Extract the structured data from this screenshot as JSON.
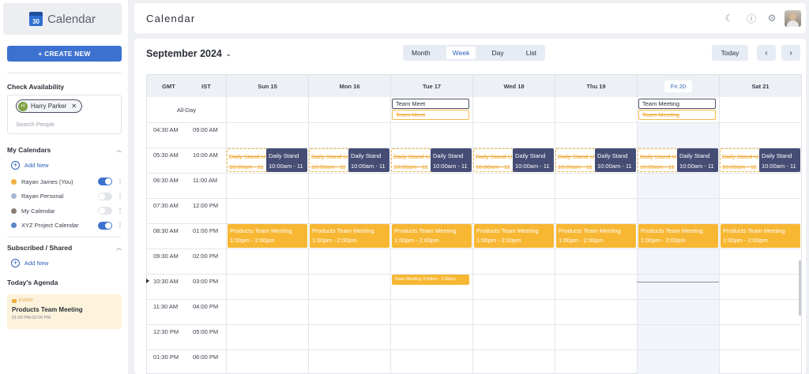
{
  "app": {
    "name": "Calendar",
    "logo_day": "30"
  },
  "sidebar": {
    "create_label": "+ CREATE NEW",
    "check_availability": {
      "title": "Check Availability",
      "chip_name": "Harry Parker",
      "chip_initial": "H",
      "search_placeholder": "Search People"
    },
    "my_calendars": {
      "title": "My Calendars",
      "add_label": "Add New",
      "items": [
        {
          "label": "Rayan James (You)",
          "color": "#f0b040",
          "enabled": true
        },
        {
          "label": "Rayan Personal",
          "color": "#a9b7d6",
          "enabled": false
        },
        {
          "label": "My Calendar",
          "color": "#8a7d72",
          "enabled": false
        },
        {
          "label": "XYZ Project Calendar",
          "color": "#5b86c9",
          "enabled": true
        }
      ]
    },
    "subscribed": {
      "title": "Subscribed / Shared",
      "add_label": "Add New"
    },
    "agenda": {
      "title": "Today's Agenda",
      "tag": "EVENT",
      "event_title": "Products Team Meeting",
      "event_time": "01:00 PM-02:00 PM"
    }
  },
  "header": {
    "title": "Calendar"
  },
  "toolbar": {
    "month_label": "September 2024",
    "views": [
      "Month",
      "Week",
      "Day",
      "List"
    ],
    "active_view": "Week",
    "today_label": "Today",
    "prev_icon": "‹",
    "next_icon": "›"
  },
  "grid": {
    "tz_primary": "GMT",
    "tz_secondary": "IST",
    "allday_label": "All-Day",
    "days": [
      "Sun 15",
      "Mon 16",
      "Tue 17",
      "Wed 18",
      "Thu 19",
      "Fri 20",
      "Sat 21"
    ],
    "today_index": 5,
    "rows": [
      {
        "gmt": "04:30 AM",
        "ist": "09:00 AM"
      },
      {
        "gmt": "05:30 AM",
        "ist": "10:00 AM"
      },
      {
        "gmt": "06:30 AM",
        "ist": "11:00 AM"
      },
      {
        "gmt": "07:30 AM",
        "ist": "12:00 PM"
      },
      {
        "gmt": "08:30 AM",
        "ist": "01:00 PM"
      },
      {
        "gmt": "09:30 AM",
        "ist": "02:00 PM"
      },
      {
        "gmt": "10:30 AM",
        "ist": "03:00 PM"
      },
      {
        "gmt": "11:30 AM",
        "ist": "04:00 PM"
      },
      {
        "gmt": "12:30 PM",
        "ist": "05:00 PM"
      },
      {
        "gmt": "01:30 PM",
        "ist": "06:00 PM"
      }
    ]
  },
  "events": {
    "allday": [
      {
        "day": 2,
        "title": "Team Meet",
        "ghost": "Team Meet"
      },
      {
        "day": 5,
        "title": "Team Meeting",
        "ghost": "Team Meeting"
      }
    ],
    "standup": {
      "title": "Daily Stand",
      "time": "10:00am - 11",
      "ghost_title": "Daily Stand-U",
      "ghost_time": "10:00am - 11"
    },
    "products": {
      "title": "Products Team Meeting",
      "time": "1:00pm - 2:00pm"
    },
    "small": {
      "day": 2,
      "label": "Team Meeting 3:00pm - 3:30pm"
    }
  }
}
